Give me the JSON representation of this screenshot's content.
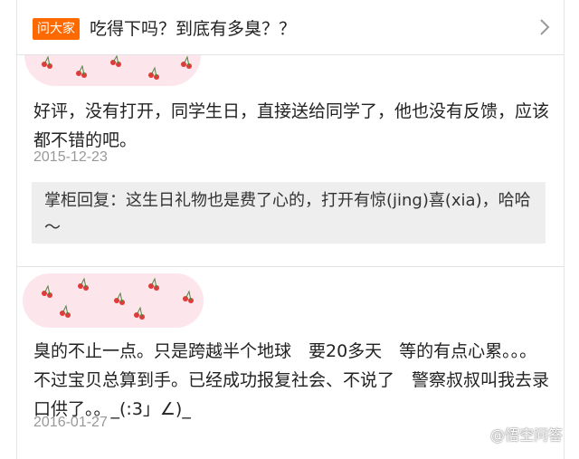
{
  "header": {
    "tag": "问大家",
    "question": "吃得下吗？到底有多臭？？"
  },
  "reviews": [
    {
      "text": "好评，没有打开，同学生日，直接送给同学了，他也没有反馈，应该都不错的吧。",
      "date": "2015-12-23",
      "reply": "掌柜回复：这生日礼物也是费了心的，打开有惊(jing)喜(xia)，哈哈～"
    },
    {
      "text": "臭的不止一点。只是跨越半个地球　要20多天　等的有点心累。。。不过宝贝总算到手。已经成功报复社会、不说了　警察叔叔叫我去录口供了。。_(:3」∠)_",
      "date": "2016-01-27"
    }
  ],
  "watermark": "@悟空问答",
  "colors": {
    "tag": "#ff6a00",
    "reply_bg": "#eeeeee",
    "date": "#999999"
  },
  "icons": {
    "chevron": "chevron-right-icon",
    "watermark": "wukong-logo-icon"
  }
}
